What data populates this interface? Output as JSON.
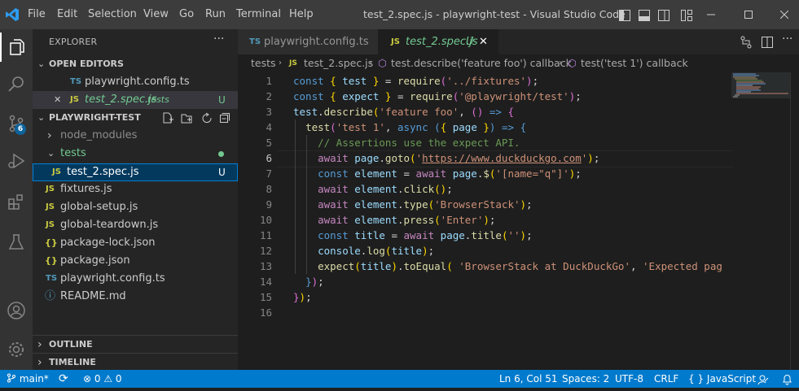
{
  "window": {
    "title": "test_2.spec.js - playwright-test - Visual Studio Code"
  },
  "menu": [
    "File",
    "Edit",
    "Selection",
    "View",
    "Go",
    "Run",
    "Terminal",
    "Help"
  ],
  "sidebar": {
    "header": "EXPLORER",
    "more": "···",
    "open_editors": {
      "label": "OPEN EDITORS",
      "items": [
        {
          "icon": "TS",
          "name": "playwright.config.ts",
          "folder": "",
          "status": ""
        },
        {
          "icon": "JS",
          "name": "test_2.spec.js",
          "folder": "tests",
          "status": "U",
          "close": "✕"
        }
      ]
    },
    "project": {
      "label": "PLAYWRIGHT-TEST",
      "items": [
        {
          "icon": "›",
          "name": "node_modules"
        },
        {
          "icon": "⌄",
          "name": "tests"
        },
        {
          "icon": "JS",
          "name": "test_2.spec.js",
          "status": "U"
        },
        {
          "icon": "JS",
          "name": "fixtures.js"
        },
        {
          "icon": "JS",
          "name": "global-setup.js"
        },
        {
          "icon": "JS",
          "name": "global-teardown.js"
        },
        {
          "icon": "{}",
          "name": "package-lock.json"
        },
        {
          "icon": "{}",
          "name": "package.json"
        },
        {
          "icon": "TS",
          "name": "playwright.config.ts"
        },
        {
          "icon": "ⓘ",
          "name": "README.md"
        }
      ]
    },
    "outline": "OUTLINE",
    "timeline": "TIMELINE"
  },
  "activity": {
    "scm_badge": "6"
  },
  "tabs": [
    {
      "icon": "TS",
      "label": "playwright.config.ts",
      "status": ""
    },
    {
      "icon": "JS",
      "label": "test_2.spec.js",
      "status": "U"
    }
  ],
  "breadcrumb": [
    "tests",
    "test_2.spec.js",
    "test.describe('feature foo') callback",
    "test('test 1') callback"
  ],
  "code": {
    "line_numbers": [
      "1",
      "2",
      "3",
      "4",
      "5",
      "6",
      "7",
      "8",
      "9",
      "10",
      "11",
      "12",
      "13",
      "14",
      "15",
      "16"
    ],
    "active_line": 6
  },
  "statusbar": {
    "branch": "main*",
    "sync": "⟳",
    "problems": "⊗ 0 ⚠ 0",
    "position": "Ln 6, Col 51",
    "spaces": "Spaces: 2",
    "encoding": "UTF-8",
    "eol": "CRLF",
    "language": "{ } JavaScript"
  },
  "colors": {
    "accent": "#007acc",
    "activity": "#333333",
    "sidebar": "#252526",
    "editor": "#1e1e1e"
  }
}
